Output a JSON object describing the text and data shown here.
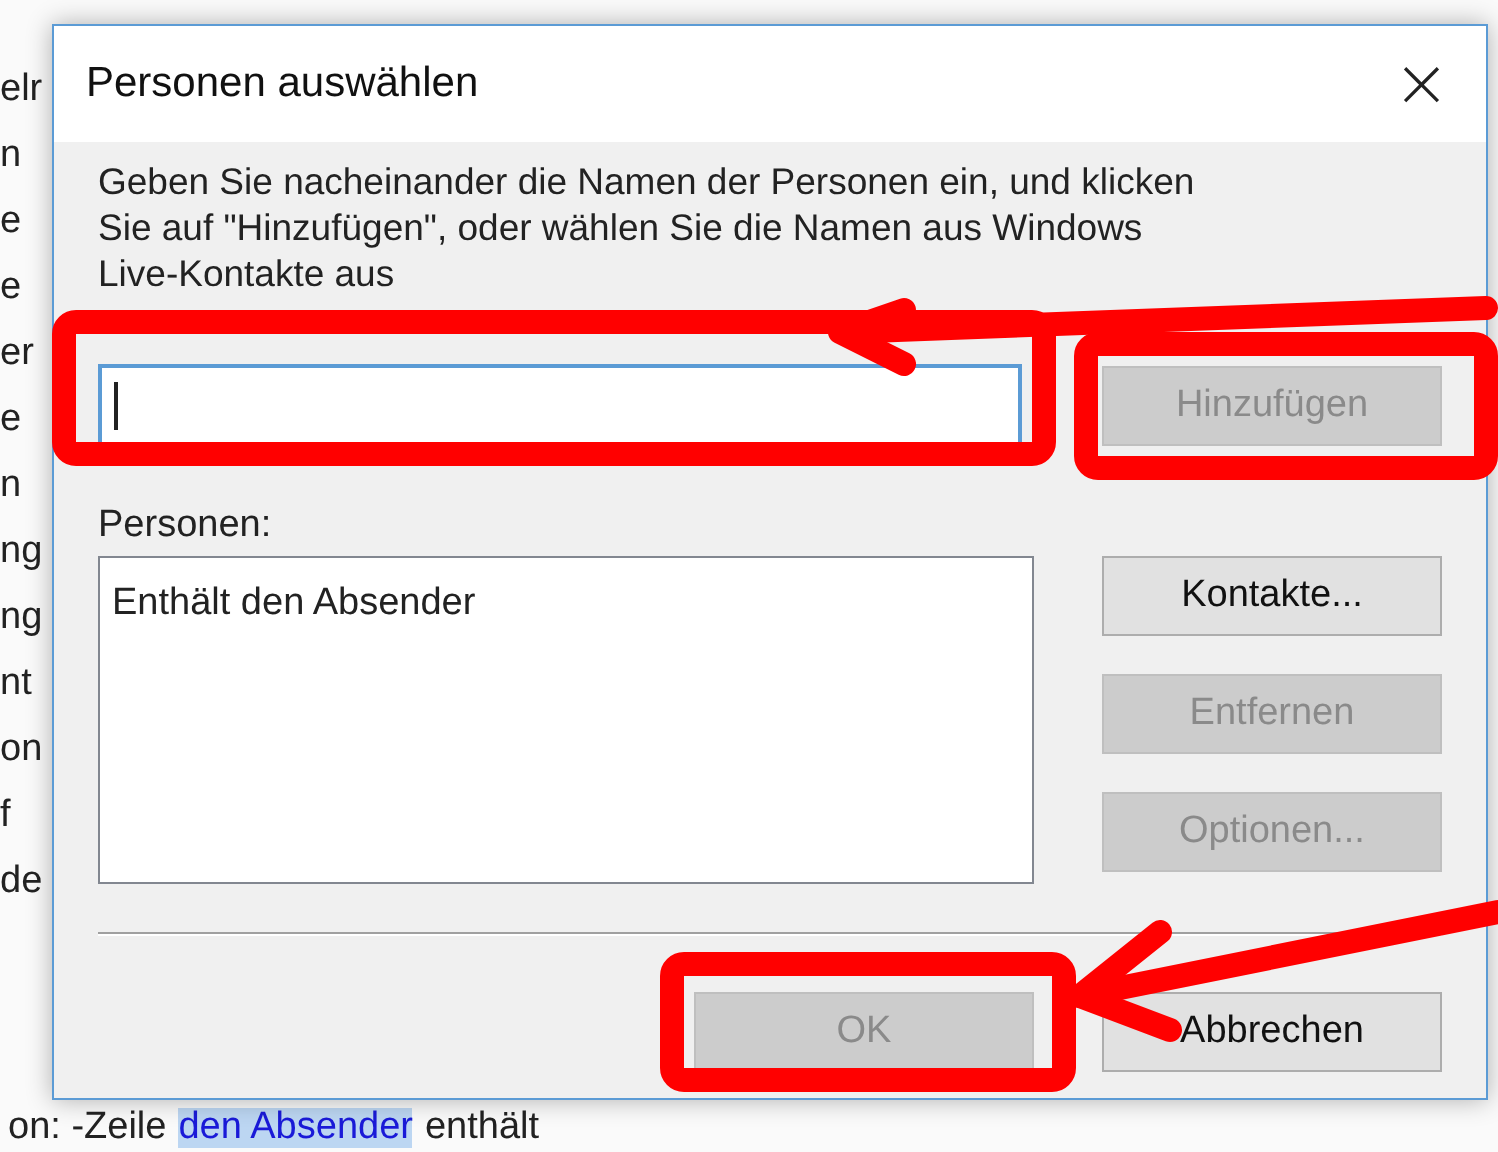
{
  "background": {
    "fragments": [
      "elr",
      "n",
      "e",
      "e",
      "er",
      "e",
      "n",
      "ng",
      "ng",
      "nt",
      "on",
      "f",
      "de"
    ],
    "status_line": {
      "prefix": "on:  -Zeile",
      "highlight": "den Absender",
      "suffix": "enthält"
    }
  },
  "dialog": {
    "title": "Personen auswählen",
    "close": "×",
    "instructions": "Geben Sie nacheinander die Namen der Personen ein, und klicken\nSie auf \"Hinzufügen\", oder wählen Sie die Namen aus Windows\nLive-Kontakte aus",
    "name_field": {
      "focused": true
    },
    "add_button": {
      "label": "Hinzufügen",
      "disabled": true
    },
    "list_label": "Personen:",
    "list_items": [
      "Enthält den Absender"
    ],
    "side_buttons": [
      {
        "label": "Kontakte...",
        "disabled": false
      },
      {
        "label": "Entfernen",
        "disabled": true
      },
      {
        "label": "Optionen...",
        "disabled": true
      }
    ],
    "footer_buttons": [
      {
        "label": "OK",
        "disabled": true
      },
      {
        "label": "Abbrechen",
        "disabled": false
      }
    ]
  }
}
